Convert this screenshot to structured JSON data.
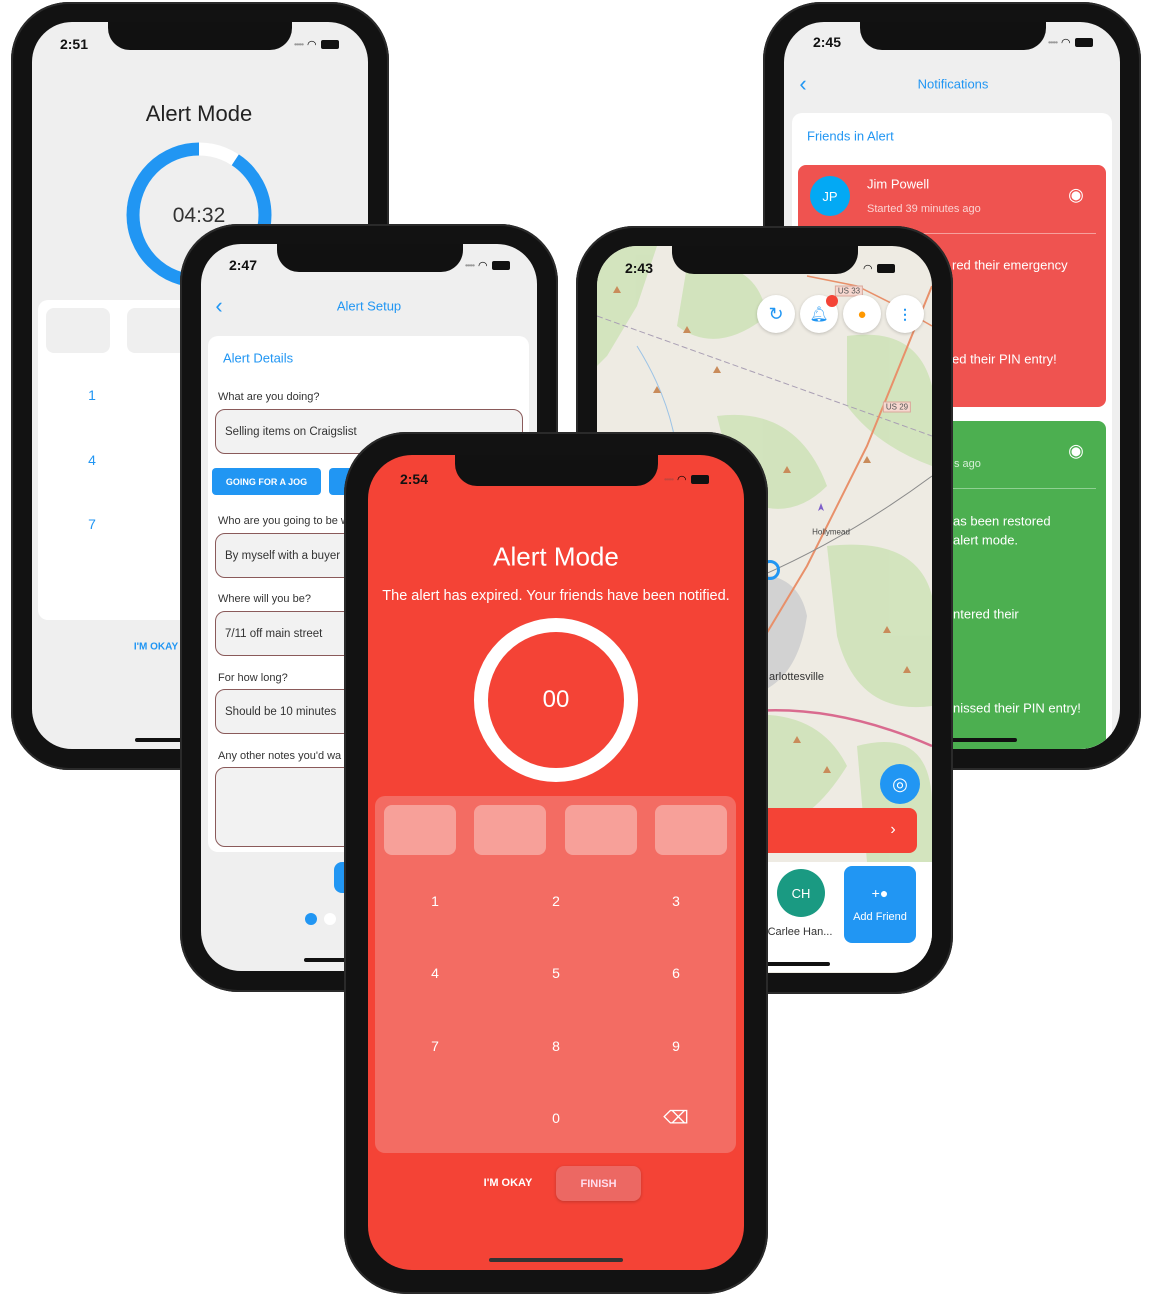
{
  "colors": {
    "blue": "#2196f3",
    "alert_red": "#f44336",
    "card_red": "#ef5350",
    "card_green": "#4caf50",
    "teal": "#1a9a82",
    "orange": "#ff9800"
  },
  "phones": {
    "timer": {
      "time": "2:51",
      "title": "Alert Mode",
      "timer": "04:32",
      "progress": 0.907,
      "keys": [
        "1",
        "4",
        "7"
      ],
      "okay": "I'M OKAY"
    },
    "notifications": {
      "time": "2:45",
      "title": "Notifications",
      "section": "Friends in Alert",
      "alert_card": {
        "initials": "JP",
        "name": "Jim Powell",
        "started": "Started 39 minutes ago",
        "line1": "red their emergency",
        "line2": "ed their PIN entry!"
      },
      "restored_card": {
        "started": "s ago",
        "line1": "as been restored",
        "line2": "alert mode.",
        "line3": "ntered their",
        "line4": "nissed their PIN entry!"
      }
    },
    "setup": {
      "time": "2:47",
      "title": "Alert Setup",
      "section": "Alert Details",
      "q1": "What are you doing?",
      "a1": "Selling items on Craigslist",
      "preset": "GOING FOR A JOG",
      "q2": "Who are you going to be w",
      "a2": "By myself with a buyer",
      "q3": "Where will you be?",
      "a3": "7/11 off main street",
      "q4": "For how long?",
      "a4": "Should be 10 minutes",
      "q5": "Any other notes you'd wa"
    },
    "map": {
      "time": "2:43",
      "labels": {
        "us33": "US 33",
        "us29": "US 29",
        "hollymead": "Hollymead",
        "city": "arlottesville"
      },
      "friend": {
        "initials": "CH",
        "name": "Carlee Han..."
      },
      "add_friend": "Add Friend"
    },
    "expired": {
      "time": "2:54",
      "title": "Alert Mode",
      "message": "The alert has expired. Your friends have been notified.",
      "timer": "00",
      "keys": [
        "1",
        "2",
        "3",
        "4",
        "5",
        "6",
        "7",
        "8",
        "9",
        "",
        "0",
        "backspace"
      ],
      "okay": "I'M OKAY",
      "finish": "FINISH"
    }
  }
}
